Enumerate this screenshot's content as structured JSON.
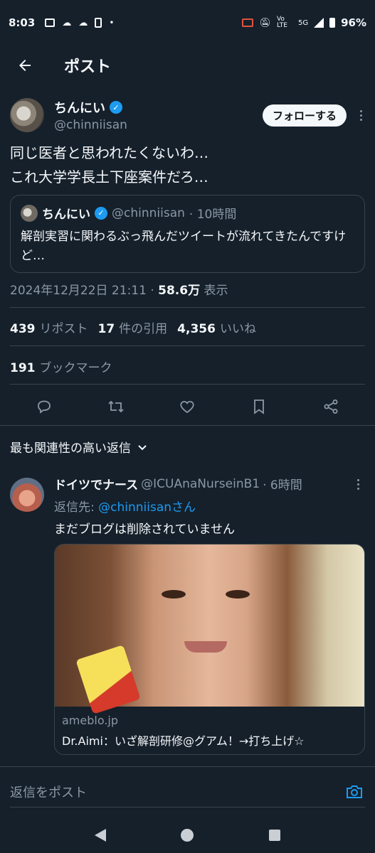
{
  "status_bar": {
    "time": "8:03",
    "battery": "96%",
    "network": "5G",
    "lte": "Vo LTE"
  },
  "header": {
    "title": "ポスト"
  },
  "author": {
    "name": "ちんにい",
    "handle": "@chinniisan",
    "follow_label": "フォローする"
  },
  "tweet": {
    "line1": "同じ医者と思われたくないわ…",
    "line2": "これ大学学長土下座案件だろ…"
  },
  "quoted": {
    "name": "ちんにい",
    "handle": "@chinniisan",
    "time": "· 10時間",
    "text": "解剖実習に関わるぶっ飛んだツイートが流れてきたんですけど…"
  },
  "meta": {
    "datetime": "2024年12月22日 21:11 · ",
    "views": "58.6万",
    "views_label": " 表示"
  },
  "stats": {
    "reposts": "439",
    "reposts_label": "リポスト",
    "quotes": "17",
    "quotes_label": "件の引用",
    "likes": "4,356",
    "likes_label": "いいね",
    "bookmarks": "191",
    "bookmarks_label": "ブックマーク"
  },
  "sort": {
    "label": "最も関連性の高い返信"
  },
  "reply": {
    "name": "ドイツでナース",
    "handle": "@ICUAnaNurseinB1",
    "time": "· 6時間",
    "reply_to_prefix": "返信先: ",
    "reply_to": "@chinniisanさん",
    "text": "まだブログは削除されていません",
    "card": {
      "domain": "ameblo.jp",
      "title": "Dr.Aimi：いざ解剖研修@グアム！→打ち上げ☆"
    }
  },
  "composer": {
    "placeholder": "返信をポスト"
  },
  "colors": {
    "background": "#15202b",
    "accent": "#1d9bf0",
    "muted": "#8b98a5",
    "border": "#38444d"
  },
  "icons": [
    "back-arrow-icon",
    "verified-icon",
    "more-icon",
    "reply-icon",
    "repost-icon",
    "like-icon",
    "bookmark-icon",
    "share-icon",
    "camera-icon",
    "chevron-down-icon"
  ]
}
